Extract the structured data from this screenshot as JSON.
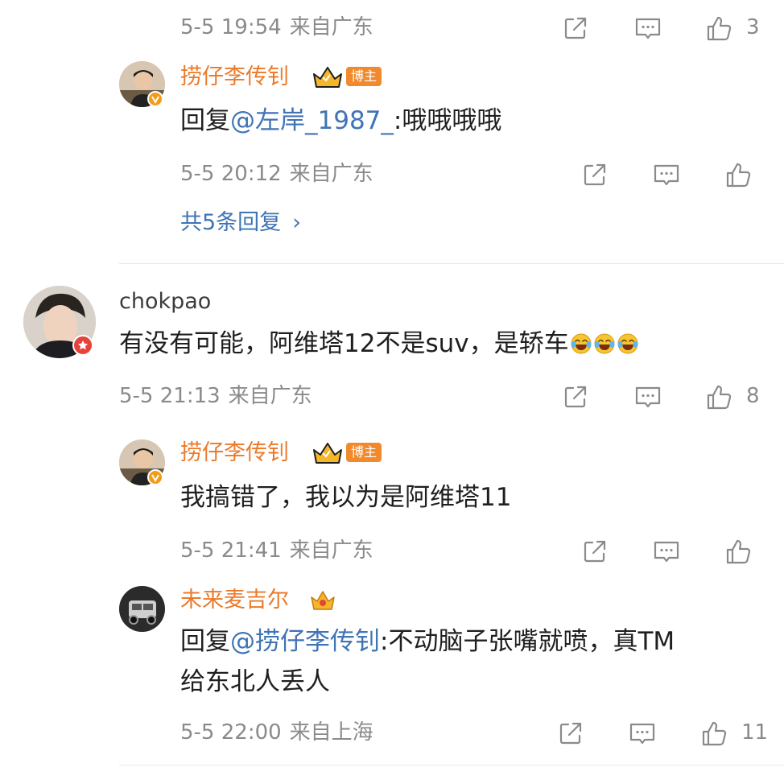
{
  "top_comment_meta": {
    "time": "5-5 19:54",
    "location": "来自广东",
    "like_count": "3"
  },
  "reply1": {
    "username": "捞仔李传钊",
    "badge_label": "博主",
    "prefix": "回复",
    "mention": "@左岸_1987_",
    "text": ":哦哦哦哦",
    "time": "5-5 20:12",
    "location": "来自广东"
  },
  "more_replies": {
    "label": "共5条回复",
    "chevron": "›"
  },
  "comment2": {
    "username": "chokpao",
    "text": "有没有可能，阿维塔12不是suv，是轿车",
    "emoji": "laugh-cry-emoji",
    "time": "5-5 21:13",
    "location": "来自广东",
    "like_count": "8"
  },
  "reply2": {
    "username": "捞仔李传钊",
    "badge_label": "博主",
    "text": "我搞错了，我以为是阿维塔11",
    "time": "5-5 21:41",
    "location": "来自广东"
  },
  "reply3": {
    "username": "未来麦吉尔",
    "prefix": "回复",
    "mention": "@捞仔李传钊",
    "text_line1": ":不动脑子张嘴就喷，真TM",
    "text_line2": "给东北人丢人",
    "time": "5-5 22:00",
    "location": "来自上海",
    "like_count": "11"
  },
  "colors": {
    "username_orange": "#eb7a2a",
    "link_blue": "#3f74b5",
    "meta_gray": "#8a8a8a",
    "blogger_tag": "#f08a2c"
  }
}
